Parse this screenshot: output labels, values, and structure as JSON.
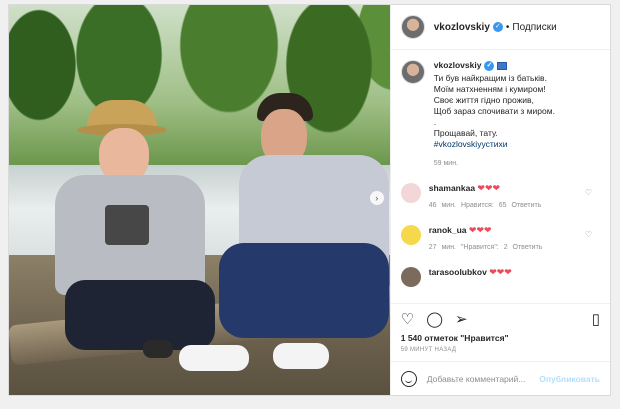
{
  "header": {
    "username": "vkozlovskiy",
    "separator": "•",
    "follow_label": "Подписки"
  },
  "caption": {
    "username": "vkozlovskiy",
    "lines": [
      "Ти був найкращим із батьків.",
      "Моїм натхненням і кумиром!",
      "Своє життя гідно прожив,",
      "Щоб зараз спочивати з миром.",
      ".",
      "Прощавай, тату."
    ],
    "hashtag": "#vkozlovskiyустихи",
    "time": "59 мин."
  },
  "comments": [
    {
      "username": "shamankaa",
      "text": "❤❤❤",
      "meta": "46 мин.  Нравится: 65  Ответить",
      "avatar_color": "#f3d6d8"
    },
    {
      "username": "ranok_ua",
      "text": "❤❤❤",
      "meta": "27 мин.  \"Нравится\": 2  Ответить",
      "avatar_color": "#f6d84a"
    },
    {
      "username": "tarasoolubkov",
      "text": "❤❤❤",
      "meta": "",
      "avatar_color": "#7a6b5d"
    }
  ],
  "likes": "1 540 отметок \"Нравится\"",
  "posted": "59 минут назад",
  "add_comment": {
    "placeholder": "Добавьте комментарий...",
    "publish_label": "Опубликовать"
  },
  "icons": {
    "like": "heart-icon",
    "comment": "comment-icon",
    "share": "share-icon",
    "save": "bookmark-icon",
    "emoji": "emoji-icon"
  },
  "colors": {
    "verified": "#3897f0",
    "heart": "#ed4956",
    "publish": "#b2dffc"
  }
}
